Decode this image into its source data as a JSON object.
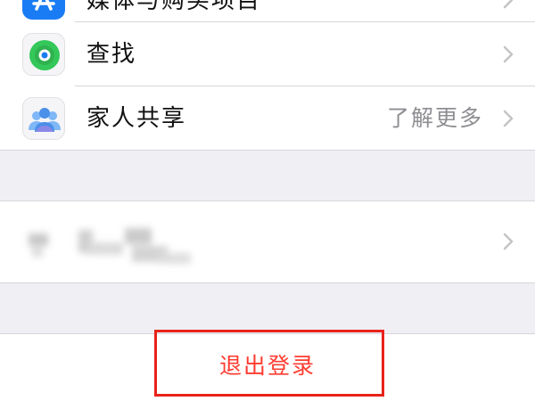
{
  "settings_list": {
    "top_row": {
      "label": "媒体与购买项目",
      "icon": "app-store-icon",
      "icon_color": "#1a7cf5"
    },
    "find_my_row": {
      "label": "查找",
      "icon": "find-my-icon",
      "icon_color": "#34c759"
    },
    "family_row": {
      "label": "家人共享",
      "detail": "了解更多",
      "icon": "family-sharing-icon",
      "icon_color": "#5aa0f0"
    }
  },
  "device_section": {
    "icon": "blurred-device-name"
  },
  "signout": {
    "label": "退出登录",
    "color": "#ff3b30",
    "highlight_color": "#e8231a"
  }
}
